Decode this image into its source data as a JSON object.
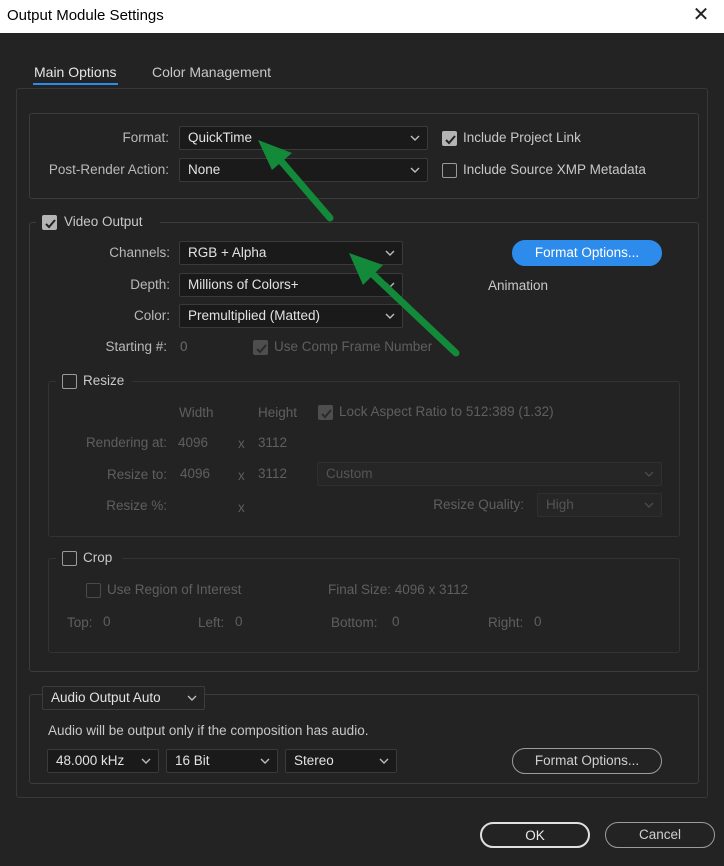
{
  "window": {
    "title": "Output Module Settings",
    "close_glyph": "✕"
  },
  "tabs": [
    {
      "label": "Main Options"
    },
    {
      "label": "Color Management"
    }
  ],
  "format": {
    "format_label": "Format:",
    "format_value": "QuickTime",
    "post_render_label": "Post-Render Action:",
    "post_render_value": "None",
    "include_project_link": {
      "label": "Include Project Link",
      "checked": true
    },
    "include_xmp": {
      "label": "Include Source XMP Metadata",
      "checked": false
    }
  },
  "video": {
    "label": "Video Output",
    "checked": true,
    "channels_label": "Channels:",
    "channels_value": "RGB + Alpha",
    "depth_label": "Depth:",
    "depth_value": "Millions of Colors+",
    "color_label": "Color:",
    "color_value": "Premultiplied (Matted)",
    "starting_label": "Starting #:",
    "starting_value": "0",
    "use_comp_frame": "Use Comp Frame Number",
    "format_options": "Format Options...",
    "codec": "Animation"
  },
  "resize": {
    "label": "Resize",
    "width_header": "Width",
    "height_header": "Height",
    "lock_aspect": "Lock Aspect Ratio to 512:389 (1.32)",
    "rendering_at_label": "Rendering at:",
    "rendering_w": "4096",
    "rendering_h": "3112",
    "resize_to_label": "Resize to:",
    "resize_w": "4096",
    "resize_h": "3112",
    "resize_preset": "Custom",
    "resize_pct_label": "Resize %:",
    "x": "x",
    "quality_label": "Resize Quality:",
    "quality_value": "High"
  },
  "crop": {
    "label": "Crop",
    "use_roi": "Use Region of Interest",
    "final_size": "Final Size: 4096 x 3112",
    "top_label": "Top:",
    "top": "0",
    "left_label": "Left:",
    "left": "0",
    "bottom_label": "Bottom:",
    "bottom": "0",
    "right_label": "Right:",
    "right": "0"
  },
  "audio": {
    "mode": "Audio Output Auto",
    "note": "Audio will be output only if the composition has audio.",
    "rate": "48.000 kHz",
    "bits": "16 Bit",
    "channels": "Stereo",
    "format_options": "Format Options..."
  },
  "footer": {
    "ok": "OK",
    "cancel": "Cancel"
  },
  "colors": {
    "accent": "#2d8ceb",
    "background": "#232323",
    "annotation_arrow": "#138a3a"
  }
}
